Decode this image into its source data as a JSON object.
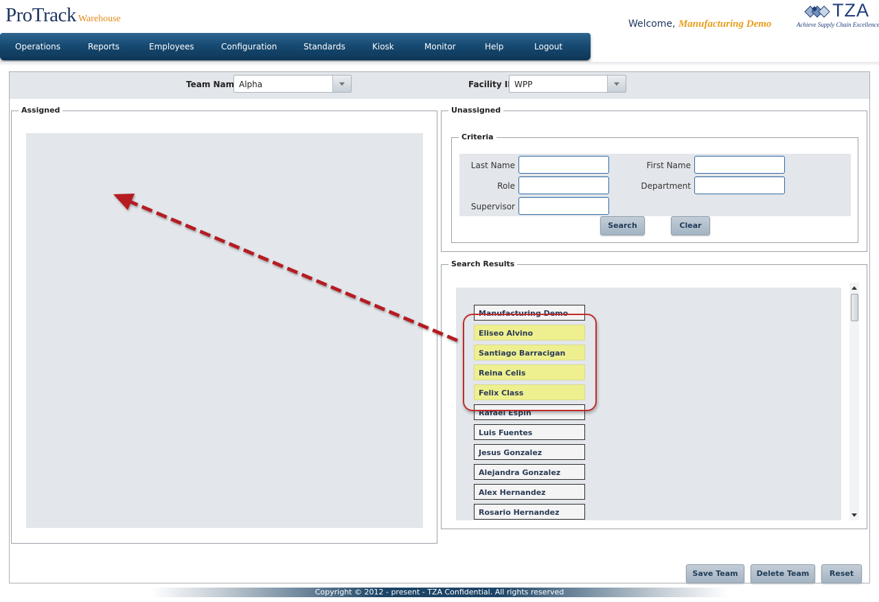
{
  "header": {
    "brand_main": "ProTrack",
    "brand_sub": "Warehouse",
    "welcome_prefix": "Welcome,",
    "user_name": "Manufacturing Demo",
    "company_logo_text": "TZA",
    "company_tagline": "Achieve Supply Chain Excellence"
  },
  "nav": {
    "items": [
      "Operations",
      "Reports",
      "Employees",
      "Configuration",
      "Standards",
      "Kiosk",
      "Monitor",
      "Help",
      "Logout"
    ]
  },
  "team_bar": {
    "team_name_label": "Team Name",
    "team_name_value": "Alpha",
    "facility_label": "Facility ID",
    "facility_value": "WPP"
  },
  "assigned": {
    "legend": "Assigned"
  },
  "unassigned": {
    "legend": "Unassigned",
    "criteria": {
      "legend": "Criteria",
      "fields": {
        "last_name": {
          "label": "Last Name",
          "value": ""
        },
        "first_name": {
          "label": "First Name",
          "value": ""
        },
        "role": {
          "label": "Role",
          "value": ""
        },
        "department": {
          "label": "Department",
          "value": ""
        },
        "supervisor": {
          "label": "Supervisor",
          "value": ""
        }
      },
      "search_label": "Search",
      "clear_label": "Clear"
    },
    "results": {
      "legend": "Search Results",
      "items": [
        {
          "name": "Manufacturing Demo",
          "selected": false
        },
        {
          "name": "Eliseo Alvino",
          "selected": true
        },
        {
          "name": "Santiago Barracigan",
          "selected": true
        },
        {
          "name": "Reina Celis",
          "selected": true
        },
        {
          "name": "Felix Class",
          "selected": true
        },
        {
          "name": "Rafael Espin",
          "selected": false
        },
        {
          "name": "Luis Fuentes",
          "selected": false
        },
        {
          "name": "Jesus Gonzalez",
          "selected": false
        },
        {
          "name": "Alejandra Gonzalez",
          "selected": false
        },
        {
          "name": "Alex Hernandez",
          "selected": false
        },
        {
          "name": "Rosario Hernandez",
          "selected": false
        }
      ]
    }
  },
  "actions": {
    "save_team": "Save Team",
    "delete_team": "Delete Team",
    "reset": "Reset"
  },
  "footer": {
    "copyright": "Copyright © 2012 - present - TZA Confidential. All rights reserved"
  },
  "colors": {
    "nav_blue": "#174a72",
    "selected_row": "#eef08f",
    "highlight_red": "#c0292b",
    "brand_orange": "#e08a16"
  }
}
